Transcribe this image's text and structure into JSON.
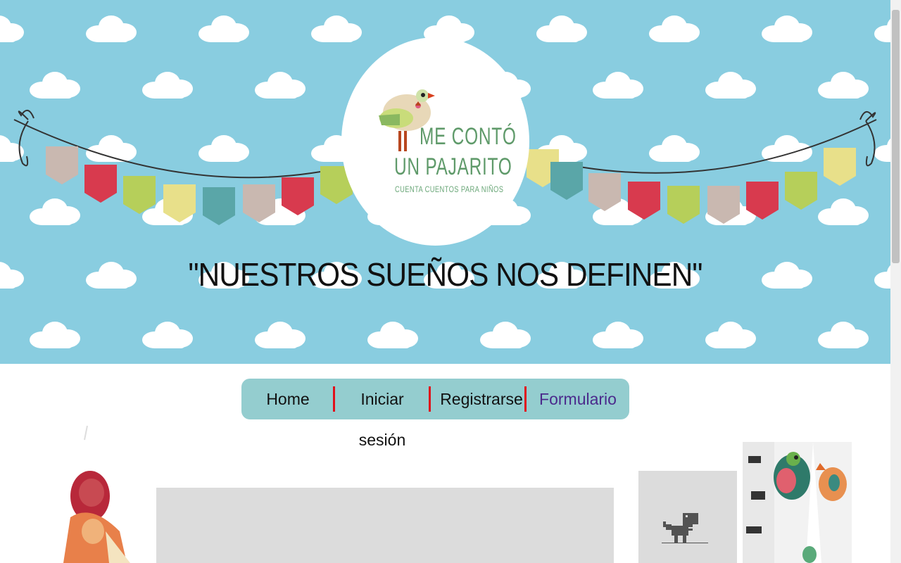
{
  "header": {
    "logo": {
      "line1": "ME CONTÓ",
      "line2": "UN PAJARITO",
      "tagline": "CUENTA CUENTOS PARA NIÑOS"
    },
    "motto": "\"NUESTROS SUEÑOS NOS DEFINEN\"",
    "background_color": "#89cde0"
  },
  "nav": {
    "items": [
      {
        "label": "Home"
      },
      {
        "label": "Iniciar sesión"
      },
      {
        "label": "Registrarse"
      },
      {
        "label": "Formulario"
      }
    ],
    "background_color": "#94cdcf",
    "separator_color": "#e0101a",
    "visited_color": "#4b2a8c"
  },
  "content": {
    "left_image": "girl-illustration",
    "video_placeholder": "blank",
    "embed_icon": "dinosaur-icon",
    "right_image": "birds-illustration"
  }
}
